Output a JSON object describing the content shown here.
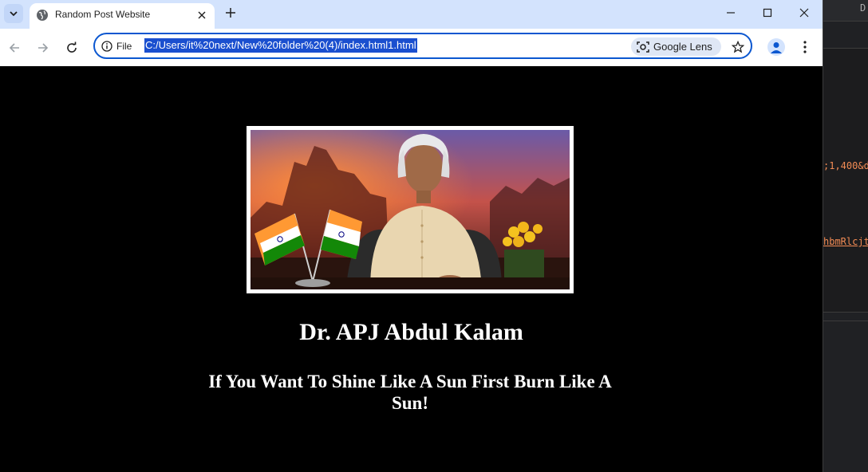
{
  "browser": {
    "tab": {
      "title": "Random Post Website",
      "favicon": "globe-icon"
    },
    "window_controls": [
      "minimize-icon",
      "maximize-icon",
      "close-icon"
    ],
    "address_bar": {
      "site_info_label": "File",
      "url": "C:/Users/it%20next/New%20folder%20(4)/index.html1.html",
      "lens_label": "Google Lens"
    },
    "colors": {
      "tabstrip": "#d3e3fd",
      "url_highlight": "#1a4fcf",
      "omnibox_border": "#0b57d0"
    }
  },
  "page": {
    "background": "#000000",
    "photo_alt": "Dr. APJ Abdul Kalam",
    "heading": "Dr. APJ Abdul Kalam",
    "quote": "If You Want To Shine Like A Sun First Burn Like A Sun!"
  },
  "devtools": {
    "top_glyph": "D",
    "code_line_1": ";1,400&d",
    "code_line_2": "hbmRlcjt"
  }
}
